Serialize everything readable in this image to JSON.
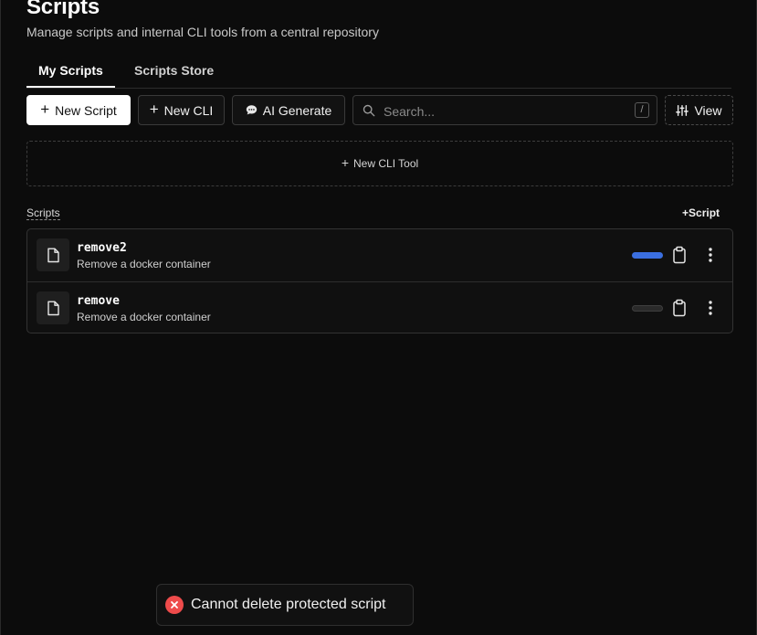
{
  "header": {
    "title": "Scripts",
    "subtitle": "Manage scripts and internal CLI tools from a central repository"
  },
  "tabs": [
    {
      "label": "My Scripts",
      "active": true
    },
    {
      "label": "Scripts Store",
      "active": false
    }
  ],
  "toolbar": {
    "new_script_label": "New Script",
    "new_cli_label": "New CLI",
    "ai_generate_label": "AI Generate",
    "search_placeholder": "Search...",
    "search_shortcut": "/",
    "view_label": "View"
  },
  "cli_drop": {
    "label": "New CLI Tool"
  },
  "scripts_section": {
    "label": "Scripts",
    "add_label": "Script",
    "items": [
      {
        "name": "remove2",
        "description": "Remove a docker container",
        "enabled": true
      },
      {
        "name": "remove",
        "description": "Remove a docker container",
        "enabled": false
      }
    ]
  },
  "toast": {
    "message": "Cannot delete protected script",
    "type": "error"
  },
  "colors": {
    "background": "#0c0c0c",
    "accent": "#3b6fe0",
    "error": "#ee4b4b",
    "primary_button": "#ffffff"
  },
  "icons": {
    "plus": "plus-icon",
    "ai": "chat-bubble-icon",
    "search": "search-icon",
    "view": "sliders-icon",
    "file": "file-icon",
    "clipboard": "clipboard-icon",
    "more": "kebab-icon",
    "error": "x-circle-icon"
  }
}
